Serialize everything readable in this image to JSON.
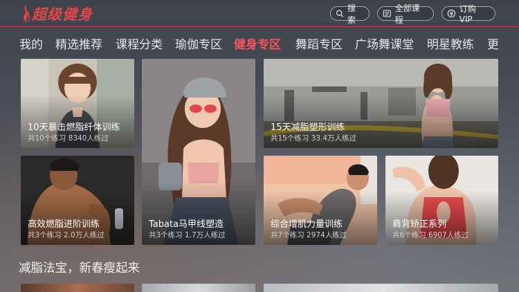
{
  "app": {
    "logo_text": "超级健身",
    "brand_color": "#e1484a"
  },
  "header": {
    "search_label": "搜索",
    "all_courses_label": "全部课程",
    "vip_label": "订购VIP"
  },
  "nav": {
    "items": [
      {
        "label": "我的"
      },
      {
        "label": "精选推荐"
      },
      {
        "label": "课程分类"
      },
      {
        "label": "瑜伽专区"
      },
      {
        "label": "健身专区",
        "active": true
      },
      {
        "label": "舞蹈专区"
      },
      {
        "label": "广场舞课堂"
      },
      {
        "label": "明星教练"
      },
      {
        "label": "更"
      }
    ],
    "active_color": "#f0555a"
  },
  "cards": [
    {
      "title": "10天暴击燃脂纤体训练",
      "meta": "共10个练习 8340人练过"
    },
    {
      "title": "Tabata马甲线塑造",
      "meta": "共3个练习 1.7万人练过"
    },
    {
      "title": "15天减脂塑形训练",
      "meta": "共15个练习 33.4万人练过"
    },
    {
      "title": "高效燃脂进阶训练",
      "meta": "共3个练习 2.0万人练过"
    },
    {
      "title": "综合增肌力量训练",
      "meta": "共7个练习 2974人练过"
    },
    {
      "title": "肩背矫正系列",
      "meta": "共6个练习 6907人练过"
    }
  ],
  "section": {
    "title": "减脂法宝，新春瘦起来"
  }
}
